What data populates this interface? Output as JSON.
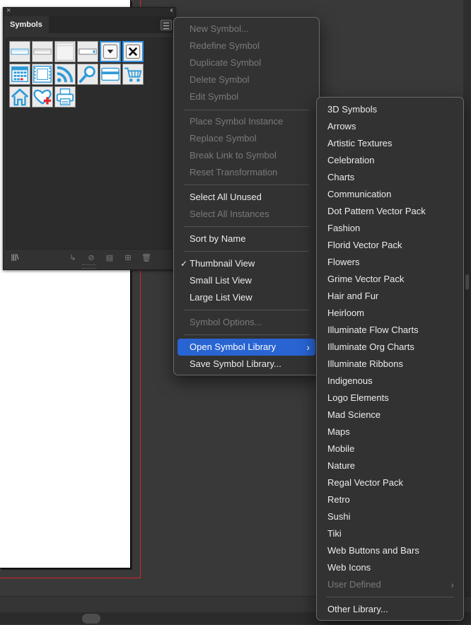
{
  "panel": {
    "tab_label": "Symbols",
    "close_glyph": "×",
    "collapse_glyph": "‹‹",
    "symbols": [
      {
        "name": "Web Button 1",
        "icon": "web-button-1-icon"
      },
      {
        "name": "Web Button 2",
        "icon": "web-button-2-icon"
      },
      {
        "name": "Web Button 3",
        "icon": "web-button-3-icon"
      },
      {
        "name": "Web Button 4",
        "icon": "web-button-4-icon"
      },
      {
        "name": "Dropdown Arrow",
        "icon": "dropdown-arrow-icon"
      },
      {
        "name": "Close X",
        "icon": "close-x-icon"
      },
      {
        "name": "Calendar",
        "icon": "calendar-icon"
      },
      {
        "name": "Film Strip",
        "icon": "film-strip-icon"
      },
      {
        "name": "RSS Feed",
        "icon": "rss-icon"
      },
      {
        "name": "Search",
        "icon": "magnifier-icon"
      },
      {
        "name": "Credit Card",
        "icon": "credit-card-icon"
      },
      {
        "name": "Shopping Cart",
        "icon": "cart-icon"
      },
      {
        "name": "Home",
        "icon": "home-icon"
      },
      {
        "name": "Heart Plus",
        "icon": "heart-plus-icon"
      },
      {
        "name": "Printer",
        "icon": "printer-icon"
      }
    ],
    "footer_icons": [
      "symbol-libraries-menu-icon",
      "place-symbol-instance-icon",
      "break-link-icon",
      "symbol-options-icon",
      "new-symbol-icon",
      "delete-symbol-icon"
    ]
  },
  "menu": {
    "items": [
      {
        "label": "New Symbol...",
        "enabled": false
      },
      {
        "label": "Redefine Symbol",
        "enabled": false
      },
      {
        "label": "Duplicate Symbol",
        "enabled": false
      },
      {
        "label": "Delete Symbol",
        "enabled": false
      },
      {
        "label": "Edit Symbol",
        "enabled": false
      },
      {
        "label": "Place Symbol Instance",
        "enabled": false
      },
      {
        "label": "Replace Symbol",
        "enabled": false
      },
      {
        "label": "Break Link to Symbol",
        "enabled": false
      },
      {
        "label": "Reset Transformation",
        "enabled": false
      },
      {
        "label": "Select All Unused",
        "enabled": true
      },
      {
        "label": "Select All Instances",
        "enabled": false
      },
      {
        "label": "Sort by Name",
        "enabled": true
      },
      {
        "label": "Thumbnail View",
        "enabled": true,
        "checked": true
      },
      {
        "label": "Small List View",
        "enabled": true
      },
      {
        "label": "Large List View",
        "enabled": true
      },
      {
        "label": "Symbol Options...",
        "enabled": false
      },
      {
        "label": "Open Symbol Library",
        "enabled": true,
        "submenu": true,
        "highlighted": true
      },
      {
        "label": "Save Symbol Library...",
        "enabled": true
      }
    ],
    "check_glyph": "✓",
    "arrow_glyph": "›"
  },
  "submenu": {
    "items": [
      {
        "label": "3D Symbols",
        "enabled": true
      },
      {
        "label": "Arrows",
        "enabled": true
      },
      {
        "label": "Artistic Textures",
        "enabled": true
      },
      {
        "label": "Celebration",
        "enabled": true
      },
      {
        "label": "Charts",
        "enabled": true
      },
      {
        "label": "Communication",
        "enabled": true
      },
      {
        "label": "Dot Pattern Vector Pack",
        "enabled": true
      },
      {
        "label": "Fashion",
        "enabled": true
      },
      {
        "label": "Florid Vector Pack",
        "enabled": true
      },
      {
        "label": "Flowers",
        "enabled": true
      },
      {
        "label": "Grime Vector Pack",
        "enabled": true
      },
      {
        "label": "Hair and Fur",
        "enabled": true
      },
      {
        "label": "Heirloom",
        "enabled": true
      },
      {
        "label": "Illuminate Flow Charts",
        "enabled": true
      },
      {
        "label": "Illuminate Org Charts",
        "enabled": true
      },
      {
        "label": "Illuminate Ribbons",
        "enabled": true
      },
      {
        "label": "Indigenous",
        "enabled": true
      },
      {
        "label": "Logo Elements",
        "enabled": true
      },
      {
        "label": "Mad Science",
        "enabled": true
      },
      {
        "label": "Maps",
        "enabled": true
      },
      {
        "label": "Mobile",
        "enabled": true
      },
      {
        "label": "Nature",
        "enabled": true
      },
      {
        "label": "Regal Vector Pack",
        "enabled": true
      },
      {
        "label": "Retro",
        "enabled": true
      },
      {
        "label": "Sushi",
        "enabled": true
      },
      {
        "label": "Tiki",
        "enabled": true
      },
      {
        "label": "Web Buttons and Bars",
        "enabled": true
      },
      {
        "label": "Web Icons",
        "enabled": true
      },
      {
        "label": "User Defined",
        "enabled": false,
        "submenu": true
      },
      {
        "label": "Other Library...",
        "enabled": true
      }
    ]
  },
  "colors": {
    "highlight": "#2864d2",
    "symbol_blue": "#2f9ad8",
    "symbol_red": "#e0262b",
    "bleed": "#d8242b"
  }
}
